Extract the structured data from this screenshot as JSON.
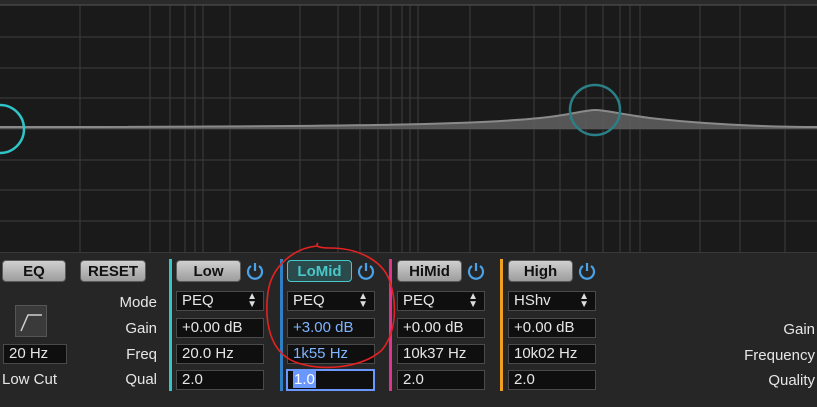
{
  "eq_button": "EQ",
  "reset_button": "RESET",
  "low_cut": {
    "freq": "20 Hz",
    "label": "Low Cut"
  },
  "row_labels": {
    "mode": "Mode",
    "gain": "Gain",
    "freq": "Freq",
    "qual": "Qual"
  },
  "right_labels": {
    "gain": "Gain",
    "frequency": "Frequency",
    "quality": "Quality"
  },
  "bands": [
    {
      "name": "Low",
      "mode": "PEQ",
      "gain": "+0.00 dB",
      "freq": "20.0 Hz",
      "q": "2.0",
      "color": "#33c7c8"
    },
    {
      "name": "LoMid",
      "mode": "PEQ",
      "gain": "+3.00 dB",
      "freq": "1k55 Hz",
      "q": "1.0",
      "color": "#2f7fc4"
    },
    {
      "name": "HiMid",
      "mode": "PEQ",
      "gain": "+0.00 dB",
      "freq": "10k37 Hz",
      "q": "2.0",
      "color": "#e0338d"
    },
    {
      "name": "High",
      "mode": "HShv",
      "gain": "+0.00 dB",
      "freq": "10k02 Hz",
      "q": "2.0",
      "color": "#f0a020"
    }
  ],
  "colors": {
    "power": "#4aa3e8",
    "annotation": "#e32222"
  }
}
